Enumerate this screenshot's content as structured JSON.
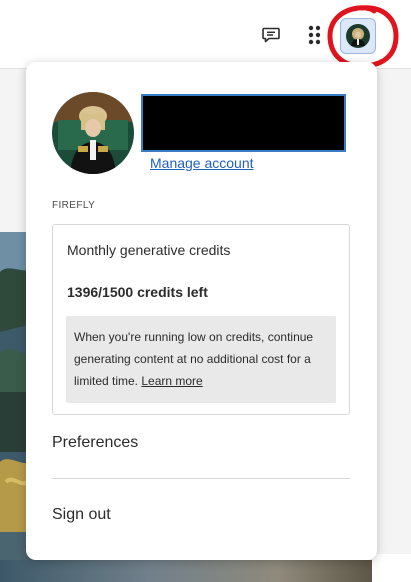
{
  "header": {
    "feedback_icon": "chat-bubble-icon",
    "apps_icon": "apps-grid-icon",
    "avatar_icon": "user-avatar-icon"
  },
  "account_menu": {
    "manage_account_label": "Manage account",
    "section_label": "FIREFLY",
    "credits_card": {
      "title": "Monthly generative credits",
      "credits_left": "1396/1500 credits left",
      "info_text": "When you're running low on credits, continue generating content at no additional cost for a limited time.",
      "learn_more_label": "Learn more"
    },
    "preferences_label": "Preferences",
    "sign_out_label": "Sign out"
  },
  "colors": {
    "link": "#1f5fbf",
    "annotation_circle": "#e0141e",
    "avatar_highlight": "#dbe8fb"
  }
}
